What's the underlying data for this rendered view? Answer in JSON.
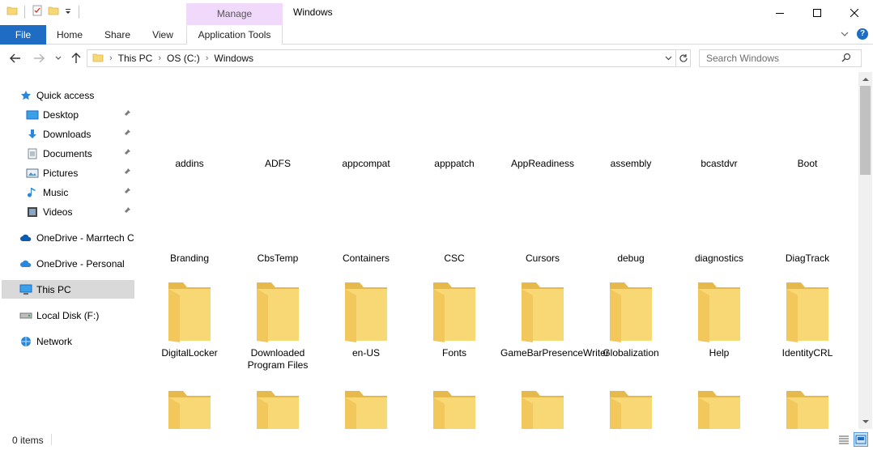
{
  "window": {
    "title": "Windows",
    "context_tab": "Manage"
  },
  "ribbon": {
    "tabs": [
      {
        "label": "File"
      },
      {
        "label": "Home"
      },
      {
        "label": "Share"
      },
      {
        "label": "View"
      },
      {
        "label": "Application Tools"
      }
    ],
    "help_glyph": "?"
  },
  "address": {
    "crumbs": [
      "This PC",
      "OS (C:)",
      "Windows"
    ]
  },
  "search": {
    "placeholder": "Search Windows"
  },
  "nav": {
    "quick_access": "Quick access",
    "pinned": [
      {
        "label": "Desktop",
        "icon": "desktop-icon"
      },
      {
        "label": "Downloads",
        "icon": "downloads-icon"
      },
      {
        "label": "Documents",
        "icon": "documents-icon"
      },
      {
        "label": "Pictures",
        "icon": "pictures-icon"
      },
      {
        "label": "Music",
        "icon": "music-icon"
      },
      {
        "label": "Videos",
        "icon": "videos-icon"
      }
    ],
    "onedrive_business": "OneDrive - Marrtech C",
    "onedrive_personal": "OneDrive - Personal",
    "this_pc": "This PC",
    "local_disk": "Local Disk (F:)",
    "network": "Network"
  },
  "folders": [
    {
      "name": "addins",
      "icon": false
    },
    {
      "name": "ADFS",
      "icon": false
    },
    {
      "name": "appcompat",
      "icon": false
    },
    {
      "name": "apppatch",
      "icon": false
    },
    {
      "name": "AppReadiness",
      "icon": false
    },
    {
      "name": "assembly",
      "icon": false
    },
    {
      "name": "bcastdvr",
      "icon": false
    },
    {
      "name": "Boot",
      "icon": false
    },
    {
      "name": "Branding",
      "icon": false
    },
    {
      "name": "CbsTemp",
      "icon": false
    },
    {
      "name": "Containers",
      "icon": false
    },
    {
      "name": "CSC",
      "icon": false
    },
    {
      "name": "Cursors",
      "icon": false
    },
    {
      "name": "debug",
      "icon": false
    },
    {
      "name": "diagnostics",
      "icon": false
    },
    {
      "name": "DiagTrack",
      "icon": false
    },
    {
      "name": "DigitalLocker",
      "icon": false
    },
    {
      "name": "Downloaded Program Files",
      "icon": false
    },
    {
      "name": "en-US",
      "icon": false
    },
    {
      "name": "Fonts",
      "icon": false
    },
    {
      "name": "GameBarPresenceWriter",
      "icon": true
    },
    {
      "name": "Globalization",
      "icon": true
    },
    {
      "name": "Help",
      "icon": true
    },
    {
      "name": "IdentityCRL",
      "icon": true
    }
  ],
  "status": {
    "items": "0 items"
  },
  "colors": {
    "accent": "#1f6cc4",
    "manage_tab": "#f0d9fa",
    "folder": "#f8d775",
    "selected": "#d9d9d9"
  }
}
